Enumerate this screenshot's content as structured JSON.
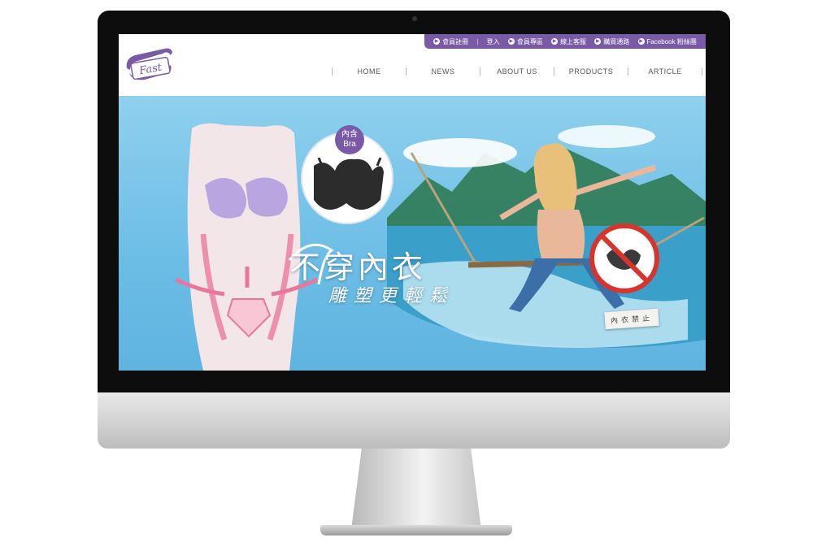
{
  "topbar": {
    "items": [
      {
        "label": "會員註冊",
        "icon": "arrow-right-icon"
      },
      {
        "label": "登入",
        "icon": ""
      },
      {
        "label": "會員專區",
        "icon": "arrow-right-icon"
      },
      {
        "label": "線上客服",
        "icon": "arrow-right-icon"
      },
      {
        "label": "購買通路",
        "icon": "arrow-right-icon"
      },
      {
        "label": "Facebook 粉絲團",
        "icon": "arrow-right-icon"
      }
    ]
  },
  "logo": {
    "text": "Fast"
  },
  "nav": {
    "items": [
      "HOME",
      "NEWS",
      "ABOUT US",
      "PRODUCTS",
      "ARTICLE"
    ]
  },
  "banner": {
    "headline": "不穿內衣",
    "subhead": "雕塑更輕鬆",
    "badge_line1": "內含",
    "badge_line2": "Bra",
    "no_bra_tag": "內衣禁止"
  },
  "colors": {
    "brand_purple": "#7a5aa6",
    "sky": "#6cbde6",
    "sea": "#3a9fc9"
  }
}
